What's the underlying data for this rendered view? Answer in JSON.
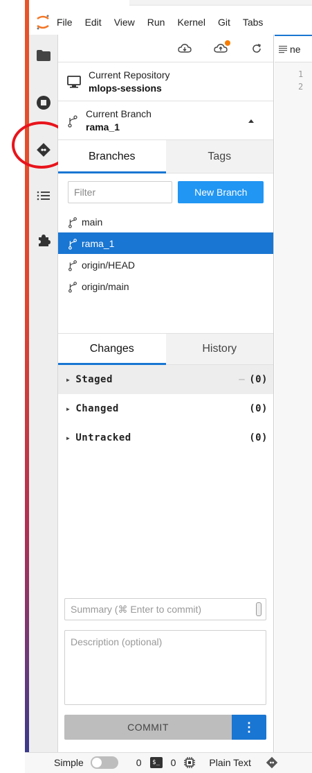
{
  "menu": [
    "File",
    "Edit",
    "View",
    "Run",
    "Kernel",
    "Git",
    "Tabs"
  ],
  "repository": {
    "label": "Current Repository",
    "name": "mlops-sessions"
  },
  "branch": {
    "label": "Current Branch",
    "name": "rama_1"
  },
  "branch_tabs": {
    "branches": "Branches",
    "tags": "Tags"
  },
  "filter": {
    "placeholder": "Filter"
  },
  "new_branch_label": "New Branch",
  "branches": [
    "main",
    "rama_1",
    "origin/HEAD",
    "origin/main"
  ],
  "selected_branch": "rama_1",
  "change_tabs": {
    "changes": "Changes",
    "history": "History"
  },
  "sections": {
    "staged": {
      "name": "Staged",
      "count": "(0)"
    },
    "changed": {
      "name": "Changed",
      "count": "(0)"
    },
    "untracked": {
      "name": "Untracked",
      "count": "(0)"
    }
  },
  "commit": {
    "summary_placeholder": "Summary (⌘ Enter to commit)",
    "description_placeholder": "Description (optional)",
    "button_label": "COMMIT",
    "more_label": "⋮"
  },
  "editor": {
    "tab_label": "ne",
    "line_numbers": [
      "1",
      "2"
    ]
  },
  "status": {
    "mode_label": "Simple",
    "terminals_count": "0",
    "kernels_count": "0",
    "file_type": "Plain Text"
  },
  "colors": {
    "accent": "#1976d2",
    "new_branch": "#2196f3",
    "highlight_circle": "#e8141c",
    "orange_dot": "#f57c00"
  }
}
